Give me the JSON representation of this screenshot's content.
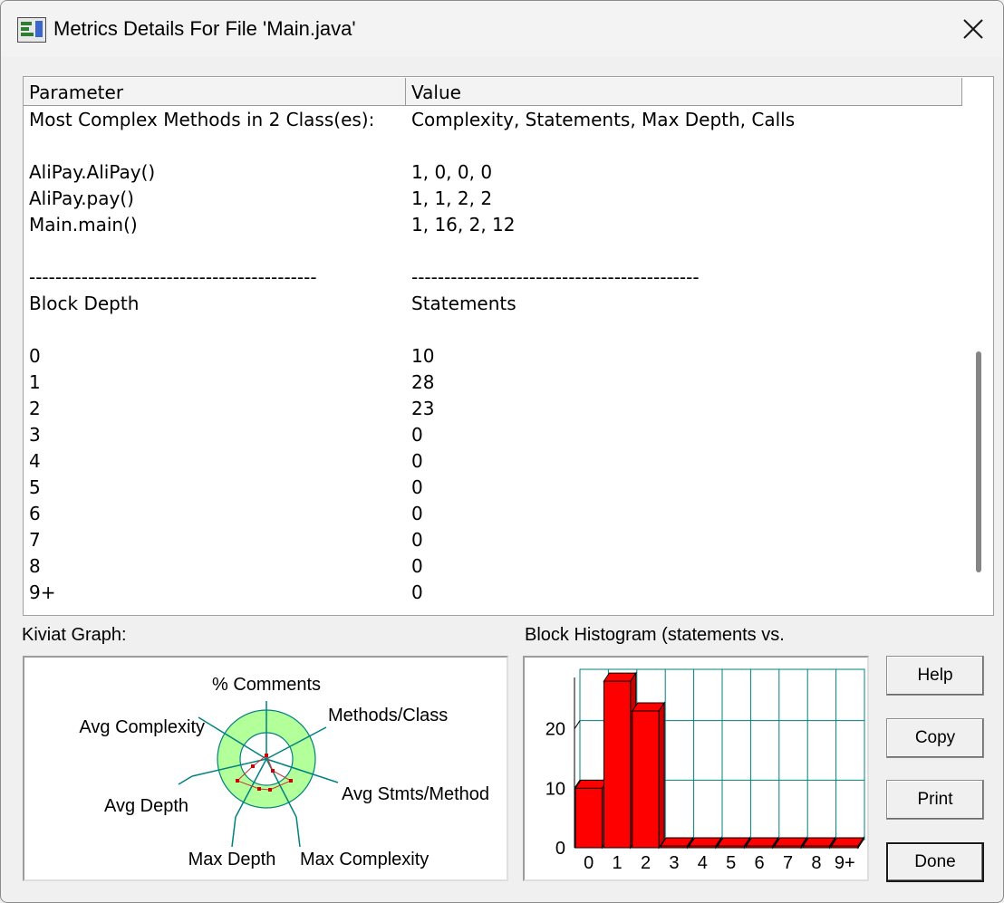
{
  "window": {
    "title": "Metrics Details For File 'Main.java'",
    "app_icon": "metrics-window-icon",
    "close_icon": "close-icon"
  },
  "table": {
    "columns": [
      "Parameter",
      "Value"
    ],
    "rows": [
      [
        "Most Complex Methods in 2 Class(es):",
        "Complexity, Statements, Max Depth, Calls"
      ],
      [
        "",
        ""
      ],
      [
        "AliPay.AliPay()",
        "1, 0, 0, 0"
      ],
      [
        "AliPay.pay()",
        "1, 1, 2, 2"
      ],
      [
        "Main.main()",
        "1, 16, 2, 12"
      ],
      [
        "",
        ""
      ],
      [
        "--------------------------------------------",
        "--------------------------------------------"
      ],
      [
        "Block Depth",
        "Statements"
      ],
      [
        "",
        ""
      ],
      [
        "0",
        "10"
      ],
      [
        "1",
        "28"
      ],
      [
        "2",
        "23"
      ],
      [
        "3",
        "0"
      ],
      [
        "4",
        "0"
      ],
      [
        "5",
        "0"
      ],
      [
        "6",
        "0"
      ],
      [
        "7",
        "0"
      ],
      [
        "8",
        "0"
      ],
      [
        "9+",
        "0"
      ]
    ]
  },
  "kiviat": {
    "label": "Kiviat Graph:",
    "axes": [
      "% Comments",
      "Methods/Class",
      "Avg Stmts/Method",
      "Max Complexity",
      "Max Depth",
      "Avg Depth",
      "Avg Complexity"
    ],
    "colors": {
      "ring": "#b3ff99",
      "axis": "#008080",
      "marker": "#cc0000"
    }
  },
  "histogram": {
    "label": "Block Histogram (statements vs.",
    "colors": {
      "bar": "#ff0000",
      "grid": "#008080"
    }
  },
  "buttons": {
    "help": "Help",
    "copy": "Copy",
    "print": "Print",
    "done": "Done"
  },
  "chart_data": {
    "type": "bar",
    "categories": [
      "0",
      "1",
      "2",
      "3",
      "4",
      "5",
      "6",
      "7",
      "8",
      "9+"
    ],
    "values": [
      10,
      28,
      23,
      0,
      0,
      0,
      0,
      0,
      0,
      0
    ],
    "yticks": [
      0,
      10,
      20
    ],
    "ylim": [
      0,
      30
    ],
    "grid": true
  }
}
